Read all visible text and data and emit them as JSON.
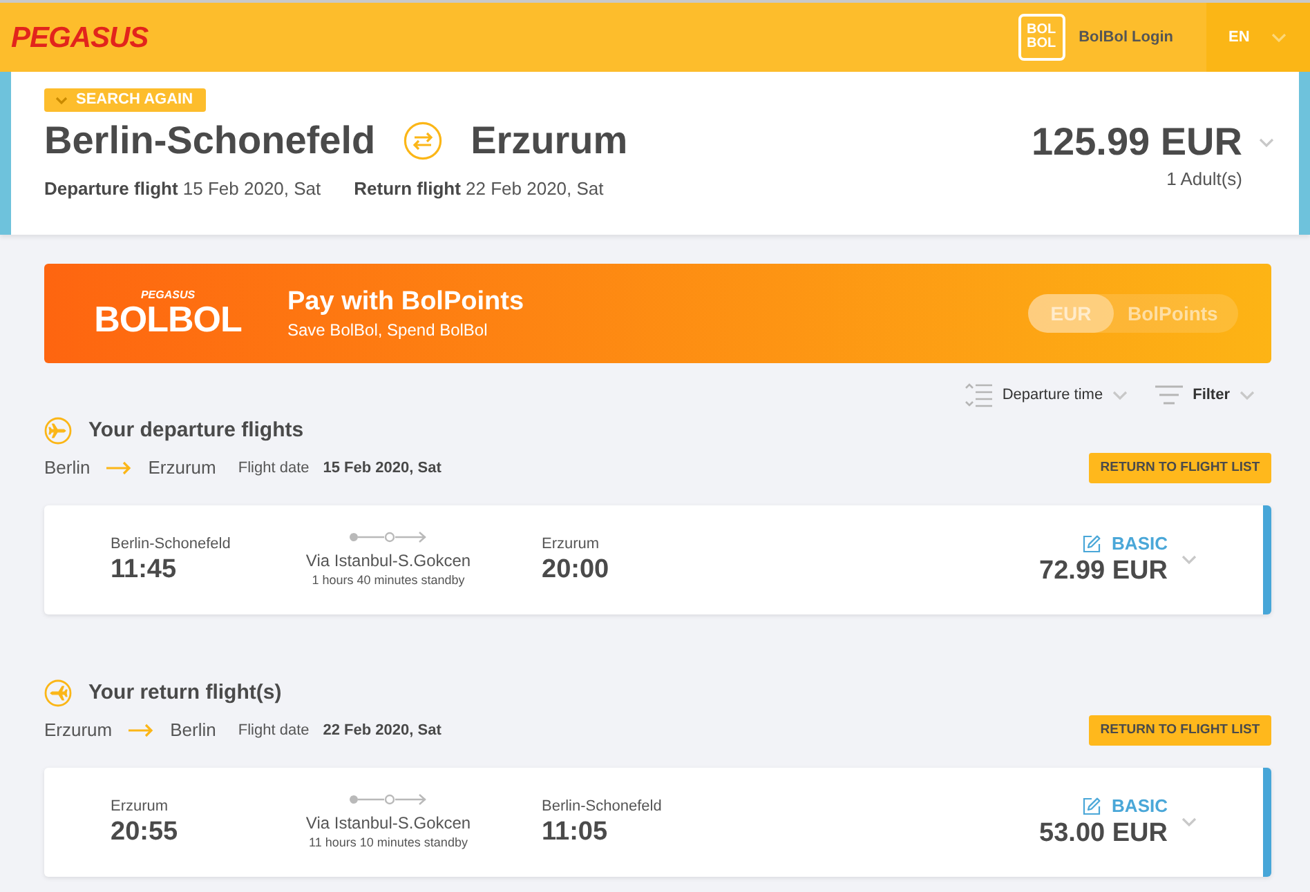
{
  "header": {
    "logo": "PEGASUS",
    "bolbol_logo": "BOL BOL",
    "login": "BolBol Login",
    "language": "EN"
  },
  "summary": {
    "search_again": "SEARCH AGAIN",
    "origin": "Berlin-Schonefeld",
    "destination": "Erzurum",
    "departure_label": "Departure flight",
    "departure_date": "15 Feb 2020, Sat",
    "return_label": "Return flight",
    "return_date": "22 Feb 2020, Sat",
    "total": "125.99 EUR",
    "passengers": "1 Adult(s)"
  },
  "promo": {
    "brand_small": "PEGASUS",
    "brand": "BOLBOL",
    "title": "Pay with BolPoints",
    "subtitle": "Save BolBol, Spend BolBol",
    "toggle": [
      {
        "label": "EUR",
        "selected": true
      },
      {
        "label": "BolPoints",
        "selected": false
      }
    ]
  },
  "toolbar": {
    "sort": "Departure time",
    "filter": "Filter"
  },
  "sections": [
    {
      "kind": "departure",
      "title": "Your departure flights",
      "from": "Berlin",
      "to": "Erzurum",
      "date_label": "Flight date",
      "date": "15 Feb 2020, Sat",
      "button": "RETURN TO FLIGHT LIST",
      "flights": [
        {
          "origin": "Berlin-Schonefeld",
          "departure_time": "11:45",
          "via": "Via Istanbul-S.Gokcen",
          "standby": "1 hours 40 minutes standby",
          "destination": "Erzurum",
          "arrival_time": "20:00",
          "fare": "BASIC",
          "price": "72.99 EUR"
        }
      ]
    },
    {
      "kind": "return",
      "title": "Your return flight(s)",
      "from": "Erzurum",
      "to": "Berlin",
      "date_label": "Flight date",
      "date": "22 Feb 2020, Sat",
      "button": "RETURN TO FLIGHT LIST",
      "flights": [
        {
          "origin": "Erzurum",
          "departure_time": "20:55",
          "via": "Via Istanbul-S.Gokcen",
          "standby": "11 hours 10 minutes standby",
          "destination": "Berlin-Schonefeld",
          "arrival_time": "11:05",
          "fare": "BASIC",
          "price": "53.00 EUR"
        }
      ]
    }
  ]
}
